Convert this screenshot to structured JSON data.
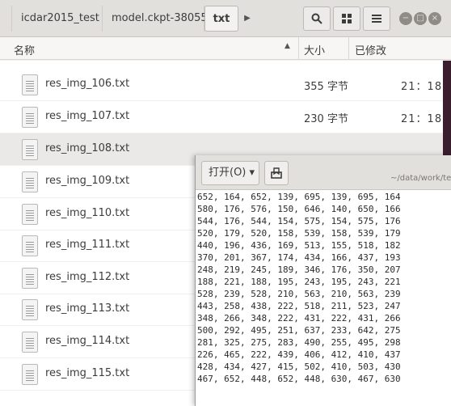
{
  "header": {
    "breadcrumbs": [
      "icdar2015_test",
      "model.ckpt-38055",
      "txt"
    ],
    "icons": [
      "search-icon",
      "grid-view-icon",
      "menu-icon"
    ],
    "window_controls": [
      "minimize-icon",
      "maximize-icon",
      "close-icon"
    ]
  },
  "columns": {
    "name": "名称",
    "size": "大小",
    "modified": "已修改"
  },
  "files": [
    {
      "name": "res_img_106.txt",
      "size": "355 字节",
      "time": "21：18"
    },
    {
      "name": "res_img_107.txt",
      "size": "230 字节",
      "time": "21：18"
    },
    {
      "name": "res_img_108.txt",
      "size": "",
      "time": ""
    },
    {
      "name": "res_img_109.txt",
      "size": "",
      "time": ""
    },
    {
      "name": "res_img_110.txt",
      "size": "",
      "time": ""
    },
    {
      "name": "res_img_111.txt",
      "size": "",
      "time": ""
    },
    {
      "name": "res_img_112.txt",
      "size": "",
      "time": ""
    },
    {
      "name": "res_img_113.txt",
      "size": "",
      "time": ""
    },
    {
      "name": "res_img_114.txt",
      "size": "",
      "time": ""
    },
    {
      "name": "res_img_115.txt",
      "size": "",
      "time": ""
    }
  ],
  "editor": {
    "open_label": "打开(O) ▾",
    "save_icon": "document-save-icon",
    "path": "~/data/work/te",
    "lines": [
      "652, 164, 652, 139, 695, 139, 695, 164",
      "580, 176, 576, 150, 646, 140, 650, 166",
      "544, 176, 544, 154, 575, 154, 575, 176",
      "520, 179, 520, 158, 539, 158, 539, 179",
      "440, 196, 436, 169, 513, 155, 518, 182",
      "370, 201, 367, 174, 434, 166, 437, 193",
      "248, 219, 245, 189, 346, 176, 350, 207",
      "188, 221, 188, 195, 243, 195, 243, 221",
      "528, 239, 528, 210, 563, 210, 563, 239",
      "443, 258, 438, 222, 518, 211, 523, 247",
      "348, 266, 348, 222, 431, 222, 431, 266",
      "500, 292, 495, 251, 637, 233, 642, 275",
      "281, 325, 275, 283, 490, 255, 495, 298",
      "226, 465, 222, 439, 406, 412, 410, 437",
      "428, 434, 427, 415, 502, 410, 503, 430",
      "467, 652, 448, 652, 448, 630, 467, 630"
    ]
  }
}
